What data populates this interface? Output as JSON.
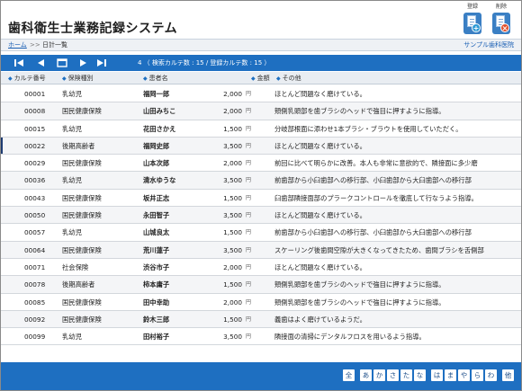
{
  "header": {
    "title": "歯科衛生士業務記録システム",
    "register_label": "登録",
    "delete_label": "削除"
  },
  "breadcrumb": {
    "home": "ホーム",
    "separator": ">>",
    "current": "日計一覧",
    "clinic": "サンプル歯科医院"
  },
  "toolbar": {
    "first_icon": "first-page-icon",
    "prev_icon": "prev-page-icon",
    "list_icon": "list-view-icon",
    "next_icon": "next-page-icon",
    "last_icon": "last-page-icon",
    "record_count": "4 （ 検索カルテ数 : 15 / 登録カルテ数 : 15 ）"
  },
  "table": {
    "columns": [
      "カルテ番号",
      "保険種別",
      "患者名",
      "金額",
      "その他"
    ],
    "currency": "円",
    "rows": [
      {
        "id": "00001",
        "insurance": "乳幼児",
        "name": "福岡一郎",
        "amount": "2,000",
        "note": "ほとんど問題なく磨けている。"
      },
      {
        "id": "00008",
        "insurance": "国民健康保険",
        "name": "山田みちこ",
        "amount": "2,000",
        "note": "頬側乳頭部を歯ブラシのヘッドで強目に押すように指導。"
      },
      {
        "id": "00015",
        "insurance": "乳幼児",
        "name": "花田さかえ",
        "amount": "1,500",
        "note": "分岐部根面に添わせ1本ブラシ・ブラウトを使用していただく。"
      },
      {
        "id": "00022",
        "insurance": "後期高齢者",
        "name": "福岡史郎",
        "amount": "3,500",
        "note": "ほとんど問題なく磨けている。"
      },
      {
        "id": "00029",
        "insurance": "国民健康保険",
        "name": "山本次郎",
        "amount": "2,000",
        "note": "前回に比べて明らかに改善。本人も非常に意欲的で、隣接面に多少磨"
      },
      {
        "id": "00036",
        "insurance": "乳幼児",
        "name": "清水ゆうな",
        "amount": "3,500",
        "note": "前歯部から小臼歯部への移行部、小臼歯部から大臼歯部への移行部"
      },
      {
        "id": "00043",
        "insurance": "国民健康保険",
        "name": "坂井正志",
        "amount": "1,500",
        "note": "臼歯部隣接面部のプラークコントロールを徹底して行なうよう指導。"
      },
      {
        "id": "00050",
        "insurance": "国民健康保険",
        "name": "永田智子",
        "amount": "3,500",
        "note": "ほとんど問題なく磨けている。"
      },
      {
        "id": "00057",
        "insurance": "乳幼児",
        "name": "山城良太",
        "amount": "1,500",
        "note": "前歯部から小臼歯部への移行部、小臼歯部から大臼歯部への移行部"
      },
      {
        "id": "00064",
        "insurance": "国民健康保険",
        "name": "荒川蓮子",
        "amount": "3,500",
        "note": "スケーリング後歯間空隙が大きくなってきたため、歯間ブラシを舌側部"
      },
      {
        "id": "00071",
        "insurance": "社会保険",
        "name": "渋谷市子",
        "amount": "2,000",
        "note": "ほとんど問題なく磨けている。"
      },
      {
        "id": "00078",
        "insurance": "後期高齢者",
        "name": "柿本庸子",
        "amount": "1,500",
        "note": "頬側乳頭部を歯ブラシのヘッドで強目に押すように指導。"
      },
      {
        "id": "00085",
        "insurance": "国民健康保険",
        "name": "田中幸助",
        "amount": "2,000",
        "note": "頬側乳頭部を歯ブラシのヘッドで強目に押すように指導。"
      },
      {
        "id": "00092",
        "insurance": "国民健康保険",
        "name": "鈴木三郎",
        "amount": "1,500",
        "note": "義歯はよく磨けているようだ。"
      },
      {
        "id": "00099",
        "insurance": "乳幼児",
        "name": "田村裕子",
        "amount": "3,500",
        "note": "隣接面の清掃にデンタルフロスを用いるよう指導。"
      }
    ]
  },
  "footer": {
    "kana": [
      "全",
      "あ",
      "か",
      "さ",
      "た",
      "な",
      "は",
      "ま",
      "や",
      "ら",
      "わ",
      "他"
    ]
  },
  "colors": {
    "primary": "#1e6fc1",
    "link": "#1a5fb4",
    "delete_badge": "#e0522e"
  }
}
